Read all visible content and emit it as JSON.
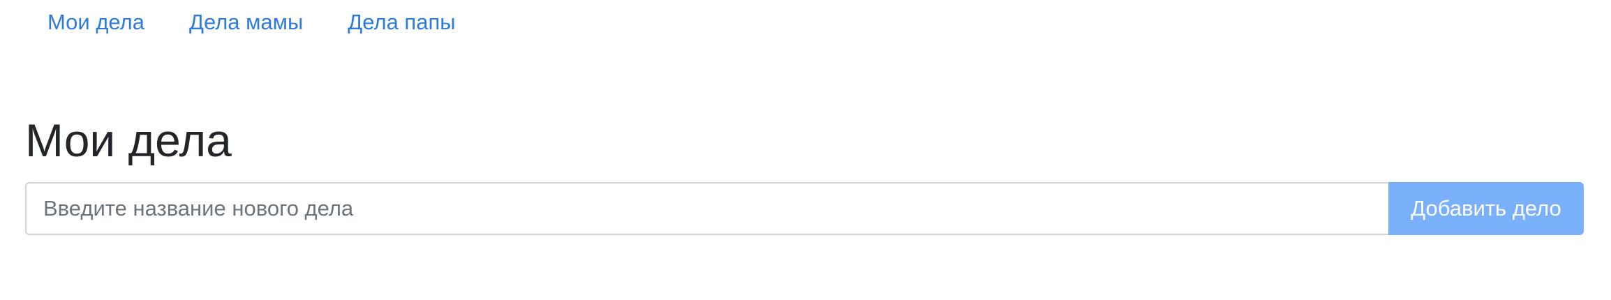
{
  "nav": {
    "links": [
      {
        "label": "Мои дела"
      },
      {
        "label": "Дела мамы"
      },
      {
        "label": "Дела папы"
      }
    ]
  },
  "main": {
    "title": "Мои дела",
    "task_input": {
      "value": "",
      "placeholder": "Введите название нового дела"
    },
    "add_button_label": "Добавить дело"
  },
  "colors": {
    "link": "#2e7bdc",
    "title_text": "#22262a",
    "button_bg": "#7ab0f9",
    "button_text": "#ffffff",
    "input_border": "#ced4da",
    "placeholder": "#6c757d"
  }
}
